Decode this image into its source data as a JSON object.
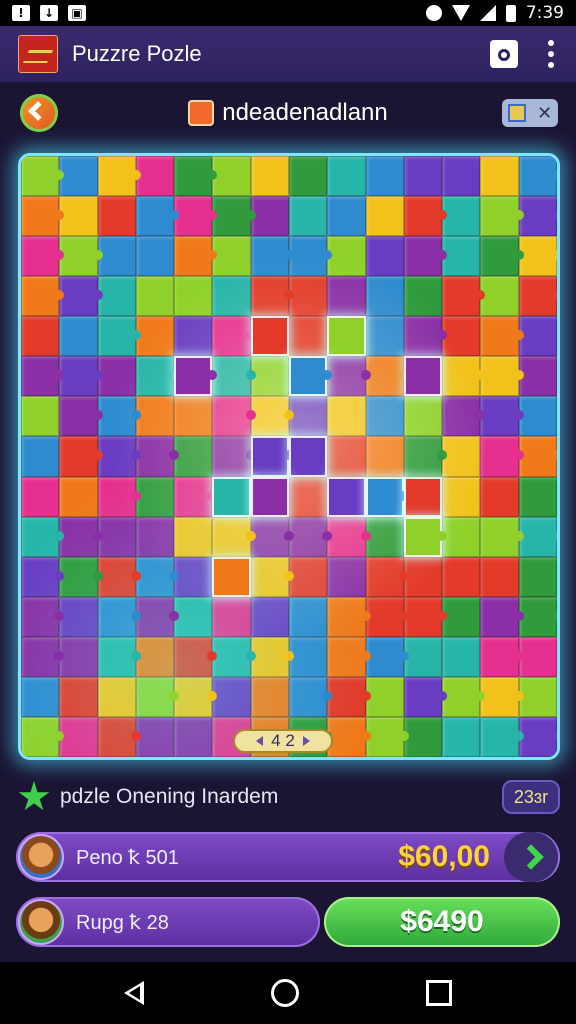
{
  "status_bar": {
    "left_icons": [
      "notification-icon",
      "download-icon",
      "photo-icon"
    ],
    "right_icons": [
      "alarm-icon",
      "wifi-icon",
      "signal-icon",
      "battery-icon"
    ],
    "time": "7:39"
  },
  "app_bar": {
    "title": "Puzzre Pozle",
    "logo_icon": "app-logo-icon",
    "action_icon": "share-icon",
    "menu_icon": "more-vert-icon"
  },
  "level": {
    "title": "ndeadenadlann",
    "back_icon": "back-arrow-icon",
    "level_icon": "puzzle-level-icon",
    "close_label": "✕"
  },
  "board": {
    "rows": 15,
    "cols": 14,
    "palette": [
      "#e33a2a",
      "#f2c21a",
      "#2f9b3c",
      "#2e8bd0",
      "#8a2fa6",
      "#e6308f",
      "#f07a1a",
      "#26b5a8",
      "#6a3cc2",
      "#8fd12a"
    ],
    "page_indicator": "4 2"
  },
  "info": {
    "label": "pdzle Onening Inardem",
    "star_icon": "star-icon",
    "badge": "23ɜr"
  },
  "players": [
    {
      "name": "Peno ꝁ 501",
      "amount": "$60,00",
      "action_icon": "chevron-right-icon",
      "accent": "#3ed64a"
    },
    {
      "name": "Rupg ꝁ 28",
      "buy_label": "$6490",
      "accent": "#2ea83a"
    }
  ],
  "nav": {
    "back_icon": "nav-back-icon",
    "home_icon": "nav-home-icon",
    "recent_icon": "nav-recent-icon"
  }
}
